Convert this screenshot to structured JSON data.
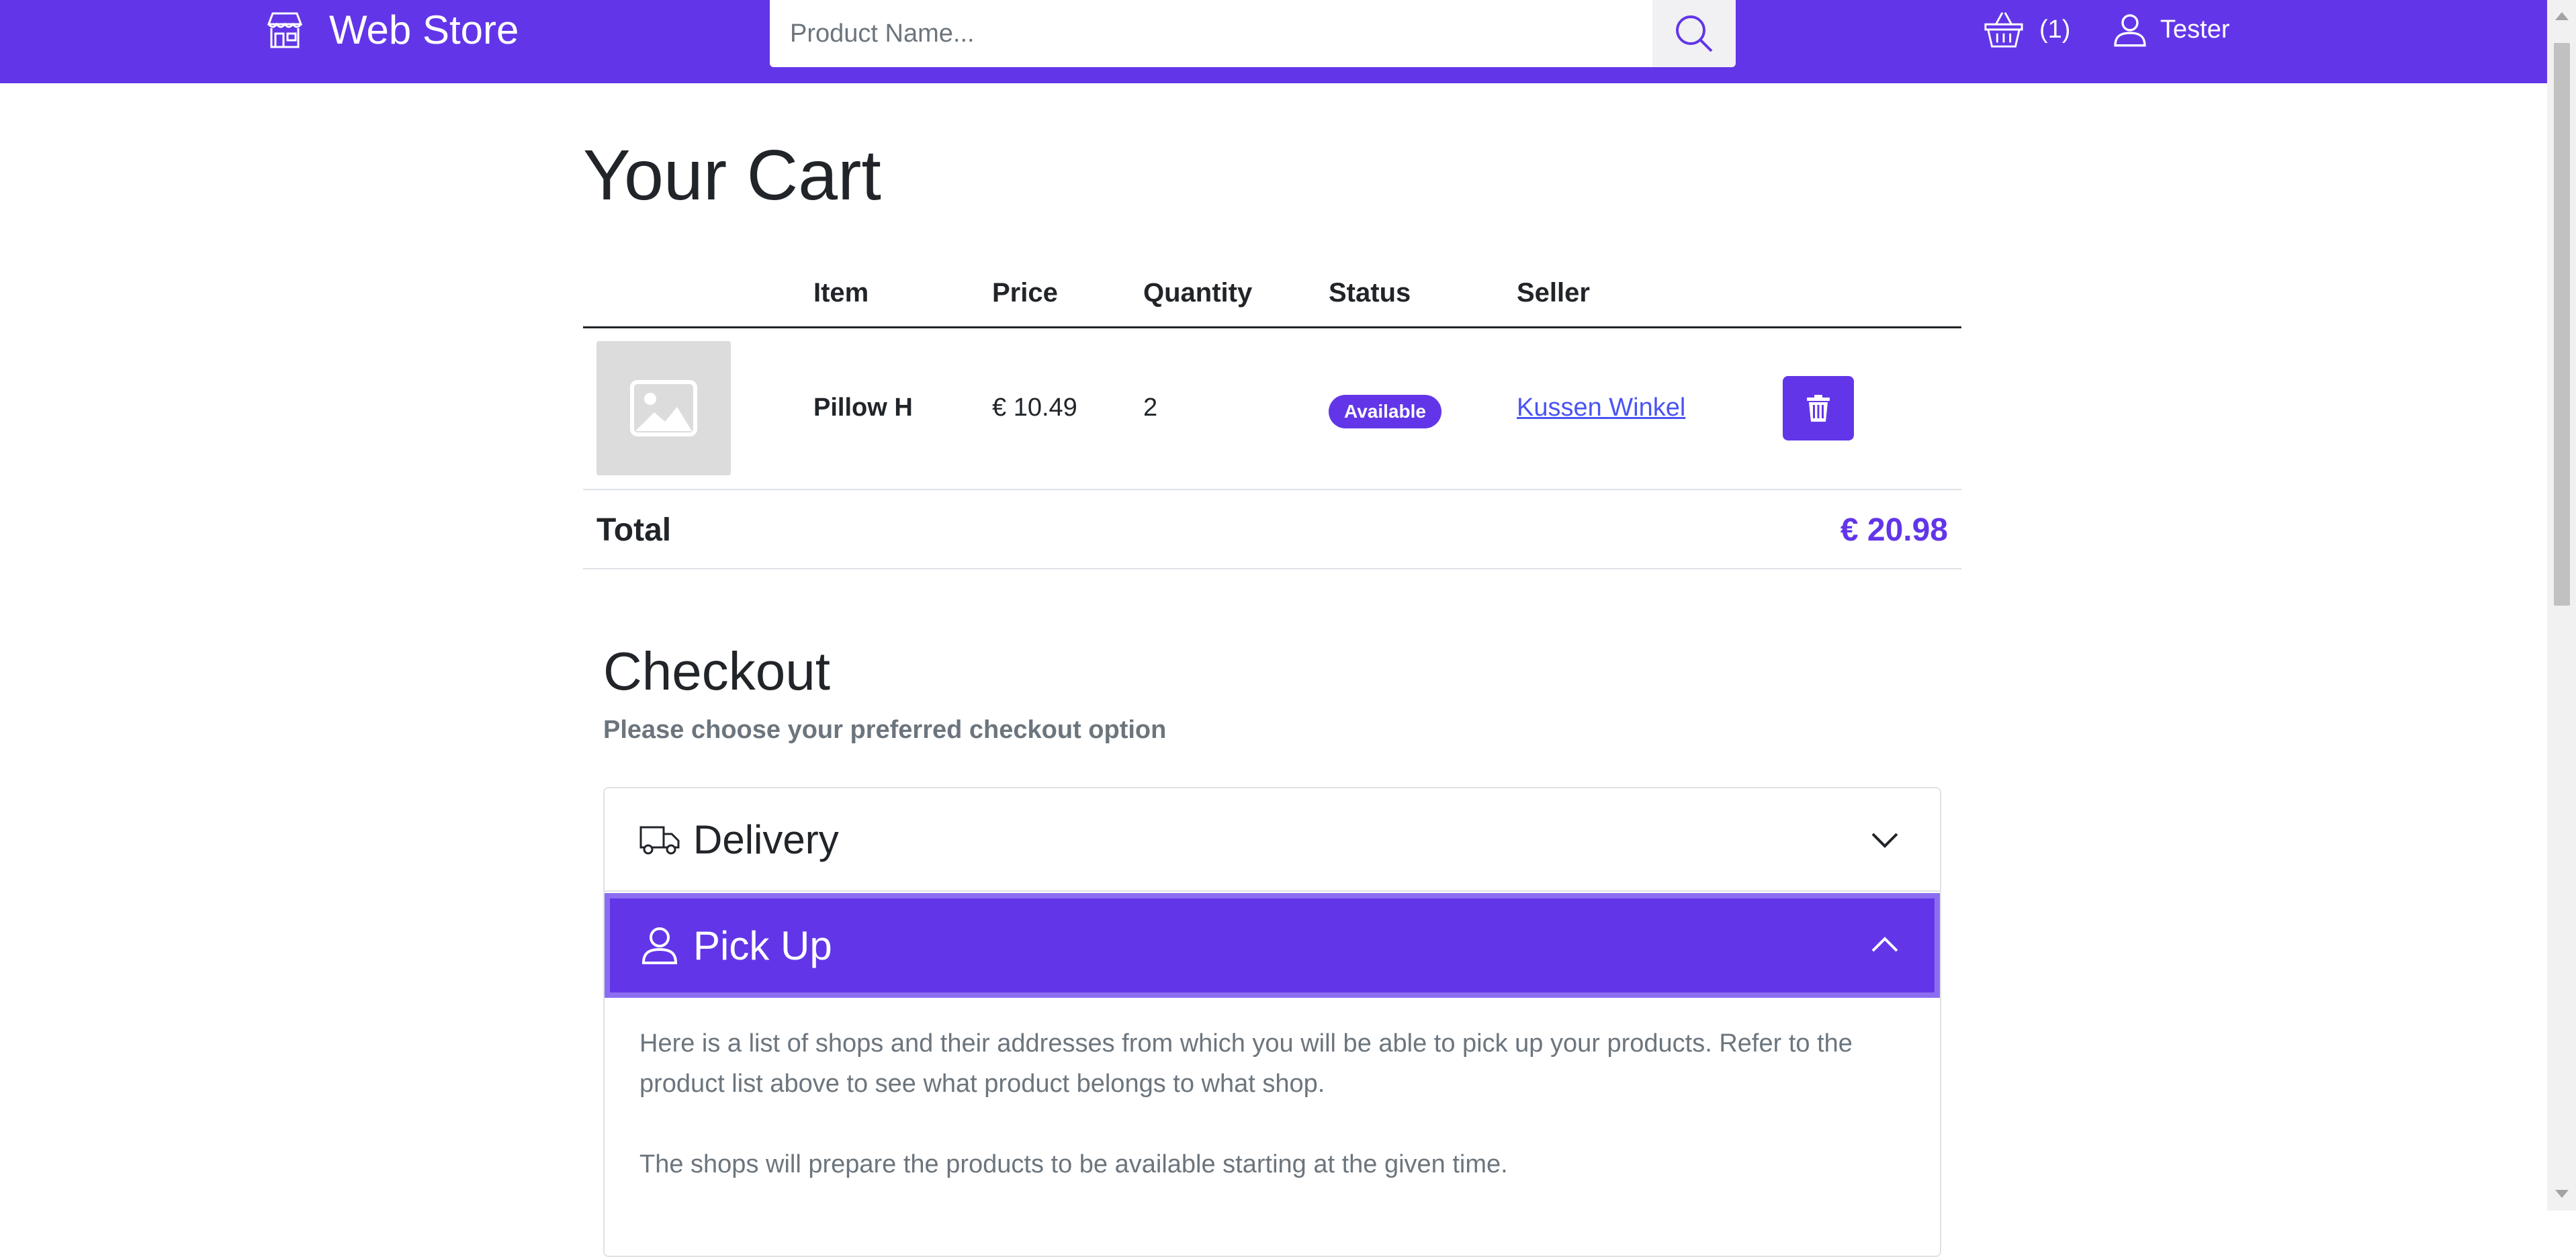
{
  "navbar": {
    "brand": "Web Store",
    "search_placeholder": "Product Name...",
    "cart_count": "(1)",
    "user_name": "Tester",
    "color": "#6236e8"
  },
  "cart": {
    "title": "Your Cart",
    "columns": [
      "Item",
      "Price",
      "Quantity",
      "Status",
      "Seller"
    ],
    "rows": [
      {
        "item": "Pillow H",
        "price": "€ 10.49",
        "quantity": "2",
        "status": "Available",
        "seller": "Kussen Winkel"
      }
    ],
    "total_label": "Total",
    "total_value": "€ 20.98"
  },
  "checkout": {
    "title": "Checkout",
    "subtitle": "Please choose your preferred checkout option",
    "options": [
      {
        "label": "Delivery",
        "icon": "truck-icon",
        "expanded": false
      },
      {
        "label": "Pick Up",
        "icon": "person-icon",
        "expanded": true
      }
    ],
    "pickup_text": [
      "Here is a list of shops and their addresses from which you will be able to pick up your products. Refer to the product list above to see what product belongs to what shop.",
      "The shops will prepare the products to be available starting at the given time."
    ]
  }
}
